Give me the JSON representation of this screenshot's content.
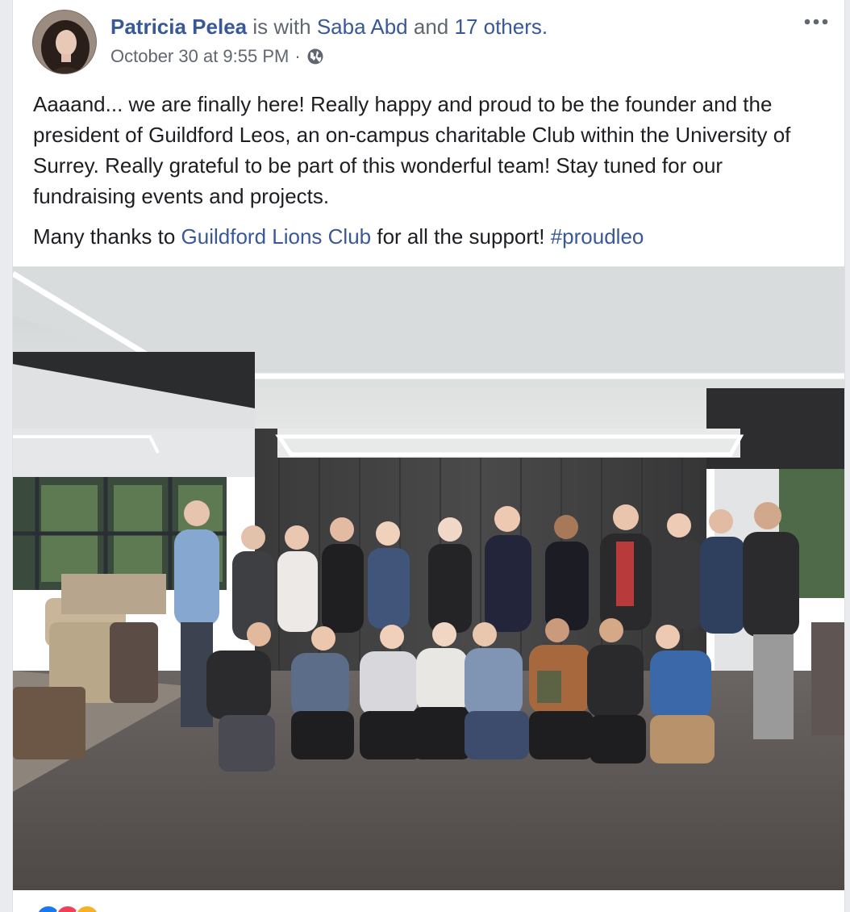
{
  "post": {
    "author": "Patricia Pelea",
    "with_word": "is with",
    "tagged_person": "Saba Abd",
    "and_word": "and",
    "tagged_others": "17 others.",
    "timestamp": "October 30 at 9:55 PM",
    "separator": "·",
    "privacy_icon": "globe-icon",
    "more_icon": "ellipsis-icon",
    "paragraph1": "Aaaand... we are finally here! Really happy and proud to be the founder and the president of Guildford Leos, an on-campus charitable Club within the University of Surrey. Really grateful to be part of this wonderful team! Stay tuned for our fundraising events and projects.",
    "thanks_prefix": "Many thanks to",
    "thanks_link": "Guildford Lions Club",
    "thanks_suffix": "for all the support!",
    "hashtag": "#proudleo"
  },
  "colors": {
    "link": "#385898",
    "text": "#1c1e21",
    "meta": "#606770",
    "background": "#e9ebee"
  }
}
